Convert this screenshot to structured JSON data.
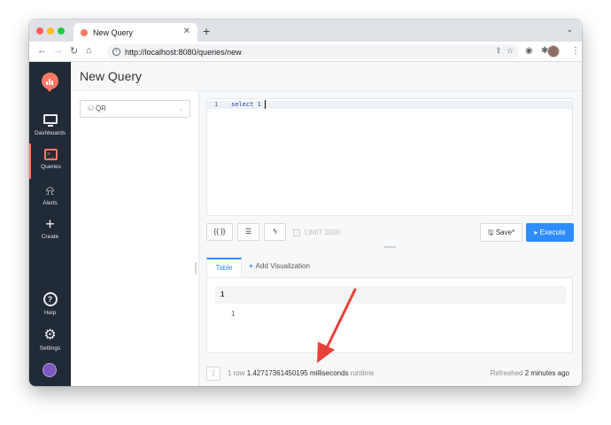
{
  "browser": {
    "tab_title": "New Query",
    "url": "http://localhost:8080/queries/new"
  },
  "sidebar": {
    "items": [
      {
        "label": "Dashboards",
        "icon": "monitor-icon"
      },
      {
        "label": "Queries",
        "icon": "terminal-icon",
        "active": true
      },
      {
        "label": "Alerts",
        "icon": "alarm-icon"
      },
      {
        "label": "Create",
        "icon": "plus-icon"
      }
    ],
    "help_label": "Help",
    "settings_label": "Settings"
  },
  "page": {
    "title": "New Query"
  },
  "datasource": {
    "selected": "QR"
  },
  "editor": {
    "line_number": "1",
    "code": "select 1"
  },
  "controls": {
    "format_label": "{{ }}",
    "limit_label": "LIMIT 1000",
    "save_label": "Save*",
    "execute_label": "Execute"
  },
  "results": {
    "tab_label": "Table",
    "add_visualization_label": "Add Visualization",
    "column_header": "1",
    "rows": [
      "1"
    ]
  },
  "footer": {
    "row_count": "1 row",
    "runtime_value": "1.42717361450195 milliseconds",
    "runtime_label": "runtime",
    "refreshed_prefix": "Refreshed",
    "refreshed_time": "2 minutes ago"
  },
  "colors": {
    "accent": "#ff7964",
    "primary": "#2e8cff",
    "sidebar_bg": "#212a37",
    "annotation_arrow": "#e8413a"
  }
}
